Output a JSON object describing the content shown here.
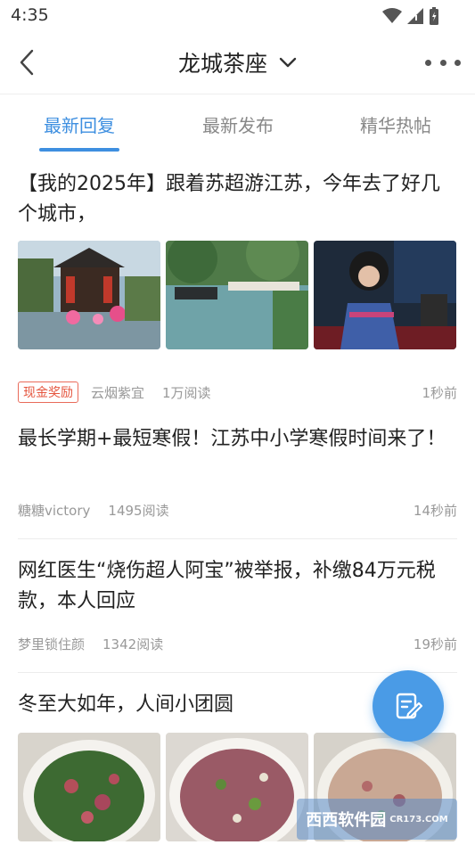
{
  "status_bar": {
    "time": "4:35"
  },
  "nav": {
    "title": "龙城茶座"
  },
  "tabs": [
    {
      "label": "最新回复",
      "active": true
    },
    {
      "label": "最新发布",
      "active": false
    },
    {
      "label": "精华热帖",
      "active": false
    }
  ],
  "posts": [
    {
      "title": "【我的2025年】跟着苏超游江苏，今年去了好几个城市，",
      "badge": "现金奖励",
      "author": "云烟紫宜",
      "reads": "1万阅读",
      "time": "1秒前"
    },
    {
      "title": "最长学期+最短寒假！江苏中小学寒假时间来了！",
      "author": "糖糖victory",
      "reads": "1495阅读",
      "time": "14秒前"
    },
    {
      "title": "网红医生“烧伤超人阿宝”被举报，补缴84万元税款，本人回应",
      "author": "梦里锁住颜",
      "reads": "1342阅读",
      "time": "19秒前"
    },
    {
      "title": "冬至大如年，人间小团圆"
    }
  ],
  "watermark": {
    "text": "西西软件园",
    "sub": "CR173.COM"
  },
  "colors": {
    "accent": "#3e8fe0",
    "badge": "#e5563f",
    "fab": "#4a9be6"
  }
}
